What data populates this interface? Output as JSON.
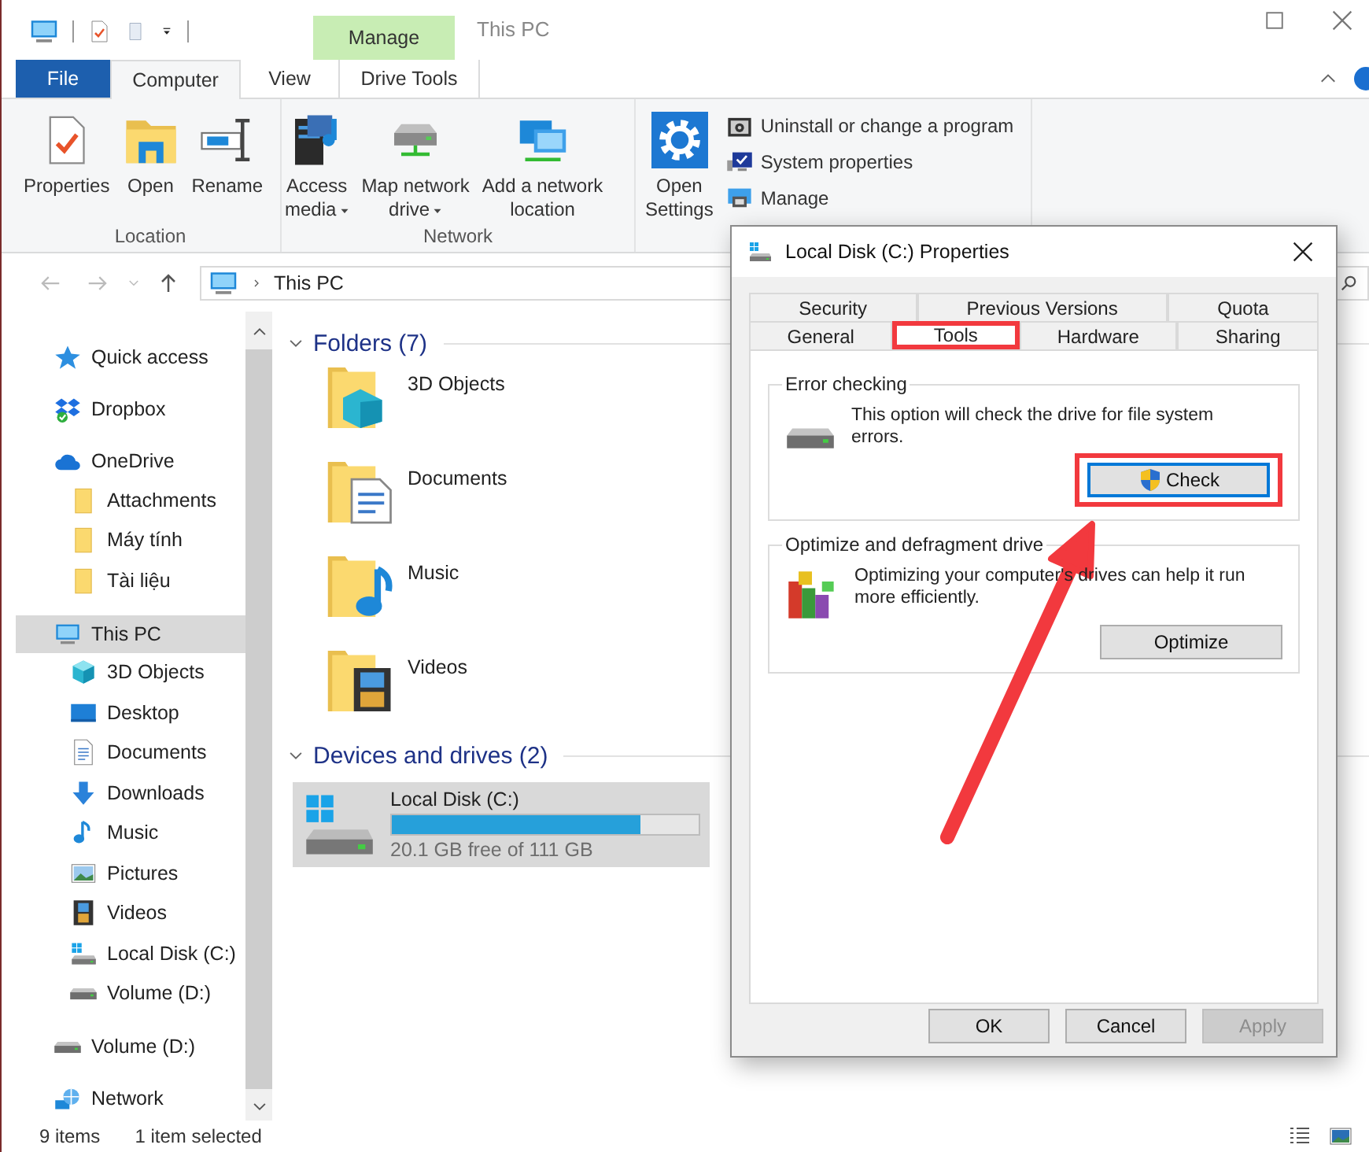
{
  "window": {
    "title": "This PC"
  },
  "context_tab_group": {
    "label": "Manage"
  },
  "ribbon_tabs": [
    {
      "label": "File",
      "kind": "file",
      "selected": false
    },
    {
      "label": "Computer",
      "kind": "tab",
      "selected": true
    },
    {
      "label": "View",
      "kind": "tab",
      "selected": false
    },
    {
      "label": "Drive Tools",
      "kind": "context",
      "selected": false
    }
  ],
  "ribbon_groups": [
    {
      "label": "Location",
      "buttons": [
        {
          "label": "Properties",
          "has_menu": false
        },
        {
          "label": "Open",
          "has_menu": false
        },
        {
          "label": "Rename",
          "has_menu": false
        }
      ]
    },
    {
      "label": "Network",
      "buttons": [
        {
          "label": "Access\nmedia",
          "has_menu": true
        },
        {
          "label": "Map network\ndrive",
          "has_menu": true
        },
        {
          "label": "Add a network\nlocation",
          "has_menu": false
        }
      ]
    },
    {
      "buttons": [
        {
          "label": "Open\nSettings",
          "has_menu": false
        }
      ],
      "small_buttons": [
        {
          "label": "Uninstall or change a program"
        },
        {
          "label": "System properties"
        },
        {
          "label": "Manage"
        }
      ]
    }
  ],
  "address_bar": {
    "path": [
      "This PC"
    ]
  },
  "navigation_pane": {
    "items": [
      {
        "label": "Quick access",
        "selected": false
      },
      {
        "label": "Dropbox",
        "selected": false
      },
      {
        "label": "OneDrive",
        "selected": false,
        "children": [
          {
            "label": "Attachments",
            "selected": false
          },
          {
            "label": "Máy tính",
            "selected": false
          },
          {
            "label": "Tài liệu",
            "selected": false
          }
        ]
      },
      {
        "label": "This PC",
        "selected": true,
        "children": [
          {
            "label": "3D Objects",
            "selected": false
          },
          {
            "label": "Desktop",
            "selected": false
          },
          {
            "label": "Documents",
            "selected": false
          },
          {
            "label": "Downloads",
            "selected": false
          },
          {
            "label": "Music",
            "selected": false
          },
          {
            "label": "Pictures",
            "selected": false
          },
          {
            "label": "Videos",
            "selected": false
          },
          {
            "label": "Local Disk (C:)",
            "selected": false
          },
          {
            "label": "Volume (D:)",
            "selected": false
          }
        ]
      },
      {
        "label": "Volume (D:)",
        "selected": false
      },
      {
        "label": "Network",
        "selected": false
      }
    ]
  },
  "content": {
    "sections": [
      {
        "title": "Folders (7)",
        "expanded": true,
        "kind": "folders",
        "items": [
          {
            "label": "3D Objects"
          },
          {
            "label": "Documents"
          },
          {
            "label": "Music"
          },
          {
            "label": "Videos"
          }
        ]
      },
      {
        "title": "Devices and drives (2)",
        "expanded": true,
        "kind": "drives",
        "items": [
          {
            "label": "Local Disk (C:)",
            "free_space": "20.1 GB free of 111 GB",
            "level": 0.81,
            "selected": true
          }
        ]
      }
    ]
  },
  "status_bar": {
    "item_count": "9 items",
    "selection": "1 item selected"
  },
  "dialog": {
    "title": "Local Disk (C:) Properties",
    "tab_rows": [
      [
        {
          "label": "Security",
          "selected": false,
          "highlighted": false
        },
        {
          "label": "Previous Versions",
          "selected": false,
          "highlighted": false
        },
        {
          "label": "Quota",
          "selected": false,
          "highlighted": false
        }
      ],
      [
        {
          "label": "General",
          "selected": false,
          "highlighted": false
        },
        {
          "label": "Tools",
          "selected": true,
          "highlighted": true
        },
        {
          "label": "Hardware",
          "selected": false,
          "highlighted": false
        },
        {
          "label": "Sharing",
          "selected": false,
          "highlighted": false
        }
      ]
    ],
    "groups": [
      {
        "title": "Error checking",
        "text": "This option will check the drive for file system errors.",
        "button": "Check",
        "shield": true,
        "focused": true,
        "button_highlighted": true
      },
      {
        "title": "Optimize and defragment drive",
        "text": "Optimizing your computer's drives can help it run more efficiently.",
        "button": "Optimize",
        "shield": false,
        "focused": false,
        "button_highlighted": false
      }
    ],
    "buttons": [
      {
        "label": "OK",
        "disabled": false
      },
      {
        "label": "Cancel",
        "disabled": false
      },
      {
        "label": "Apply",
        "disabled": true
      }
    ],
    "annotation_arrow": true
  }
}
